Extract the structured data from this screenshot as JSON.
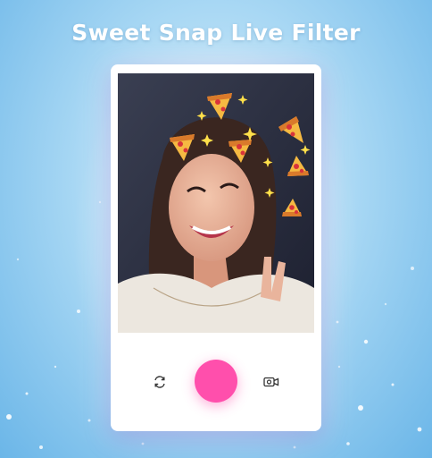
{
  "header": {
    "title": "Sweet Snap Live Filter"
  },
  "camera": {
    "preview_label": "Live camera preview with pizza filter",
    "filter_icon": "pizza-slice-icon",
    "sparkle_icon": "star-sparkle-icon"
  },
  "controls": {
    "switch_camera_icon": "refresh-icon",
    "shutter_icon": "capture-icon",
    "video_icon": "video-camera-icon"
  },
  "colors": {
    "background": "#a9d8f4",
    "accent": "#ff4fac",
    "card": "#ffffff"
  }
}
